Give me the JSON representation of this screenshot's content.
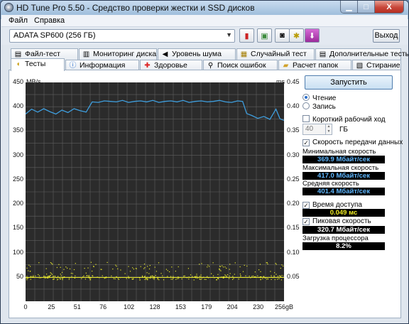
{
  "window": {
    "title": "HD Tune Pro 5.50 - Средство проверки жестки и SSD дисков",
    "min_icon": "minimize-icon",
    "max_icon": "maximize-icon",
    "close_label": "X"
  },
  "menu": [
    "Файл",
    "Справка"
  ],
  "toolbar": {
    "drive": "ADATA   SP600 (256 ГБ)",
    "icons": [
      "temperature-icon",
      "copy-icon",
      "camera-icon",
      "options-icon",
      "save-icon"
    ],
    "exit_label": "Выход"
  },
  "tabs_row1": [
    "Файл-тест",
    "Мониторинг диска",
    "Уровень шума",
    "Случайный тест",
    "Дополнительные тесты"
  ],
  "tabs_row2": [
    "Тесты",
    "Информация",
    "Здоровье",
    "Поиск ошибок",
    "Расчет папок",
    "Стирание"
  ],
  "controls": {
    "start_label": "Запустить",
    "read_label": "Чтение",
    "write_label": "Запись",
    "short_stroke_label": "Короткий рабочий ход",
    "short_stroke_value": "40",
    "short_stroke_unit": "ГБ",
    "transfer_label": "Скорость передачи данных",
    "min_label": "Минимальная скорость",
    "min_value": "369.9 Мбайт/сек",
    "max_label": "Максимальная скорость",
    "max_value": "417.0 Мбайт/сек",
    "avg_label": "Средняя скорость",
    "avg_value": "401.4 Мбайт/сек",
    "access_label": "Время доступа",
    "access_value": "0.049 мс",
    "burst_label": "Пиковая скорость",
    "burst_value": "320.7 Мбайт/сек",
    "cpu_label": "Загрузка процессора",
    "cpu_value": "8.2%"
  },
  "chart_data": {
    "type": "line",
    "ylabel_left": "MB/s",
    "ylabel_right": "ms",
    "x_unit": "gB",
    "x_ticks": [
      "0",
      "25",
      "51",
      "76",
      "102",
      "128",
      "153",
      "179",
      "204",
      "230",
      "256gB"
    ],
    "y_ticks_left": [
      "450",
      "400",
      "350",
      "300",
      "250",
      "200",
      "150",
      "100",
      "50"
    ],
    "y_ticks_right": [
      "0.45",
      "0.40",
      "0.35",
      "0.30",
      "0.25",
      "0.20",
      "0.15",
      "0.10",
      "0.05"
    ],
    "ylim_left": [
      0,
      450
    ],
    "ylim_right": [
      0,
      0.45
    ],
    "xlim": [
      0,
      256
    ],
    "grid": true,
    "series": [
      {
        "role": "transfer",
        "color": "#3f9fdf",
        "x": [
          0,
          6,
          12,
          18,
          24,
          30,
          36,
          42,
          48,
          54,
          60,
          66,
          72,
          78,
          84,
          90,
          96,
          102,
          108,
          114,
          120,
          126,
          132,
          138,
          144,
          150,
          156,
          162,
          168,
          174,
          180,
          186,
          192,
          198,
          204,
          210,
          215,
          219,
          224,
          230,
          236,
          242,
          248,
          252,
          256
        ],
        "y": [
          385,
          395,
          389,
          396,
          390,
          385,
          393,
          388,
          396,
          392,
          389,
          410,
          409,
          412,
          411,
          410,
          413,
          409,
          411,
          412,
          410,
          413,
          409,
          411,
          412,
          410,
          413,
          409,
          411,
          412,
          410,
          411,
          413,
          410,
          409,
          412,
          411,
          386,
          382,
          376,
          380,
          374,
          395,
          375,
          372
        ]
      },
      {
        "role": "access-time",
        "color": "#e6e62a",
        "x": [
          0,
          256
        ],
        "y": [
          0.049,
          0.049
        ]
      }
    ]
  },
  "colors": {
    "chart_bg": "#2b2b2b",
    "grid": "#5f5f5f",
    "transfer": "#3f9fdf",
    "access": "#e6e62a",
    "accent": "#4f7dae"
  }
}
